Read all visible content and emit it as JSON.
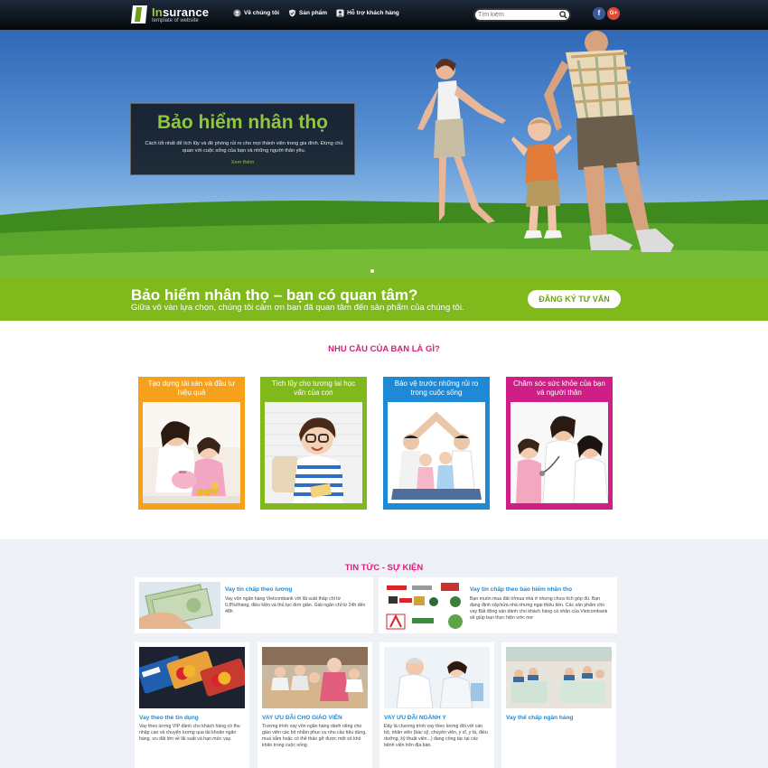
{
  "header": {
    "logo_brand_prefix": "In",
    "logo_brand_rest": "surance",
    "logo_tagline": "template of website",
    "nav": [
      {
        "label": "Về chúng tôi",
        "icon": "users-icon"
      },
      {
        "label": "Sản phẩm",
        "icon": "shield-icon"
      },
      {
        "label": "Hỗ trợ khách hàng",
        "icon": "support-icon"
      }
    ],
    "search_placeholder": "Tìm kiếm",
    "social": [
      {
        "label": "f",
        "icon": "facebook-icon",
        "color": "#3b5998"
      },
      {
        "label": "G+",
        "icon": "google-plus-icon",
        "color": "#dd4b39"
      }
    ]
  },
  "hero": {
    "title": "Bảo hiểm nhân thọ",
    "text": "Cách tốt nhất để tích lũy và đề phòng rủi ro cho mọi thành viên trong gia đình. Đừng chủ quan với cuộc sống của bạn và những người thân yêu.",
    "link": "Xem thêm"
  },
  "cta": {
    "title": "Bảo hiểm nhân thọ – bạn có quan tâm?",
    "subtitle": "Giữa vô vàn lựa chọn, chúng tôi cảm ơn bạn đã quan tâm đến sản phẩm của chúng tôi.",
    "button": "ĐĂNG KÝ TƯ VẤN"
  },
  "needs": {
    "title": "NHU CẦU CỦA BẠN LÀ GÌ?",
    "cards": [
      {
        "label": "Tạo dựng tài sản và đầu tư hiệu quả",
        "color": "#f7a11a"
      },
      {
        "label": "Tích lũy cho tương lai học vấn của con",
        "color": "#7fb91b"
      },
      {
        "label": "Bảo vệ trước những rủi ro trong cuộc sống",
        "color": "#1e8ad6"
      },
      {
        "label": "Chăm sóc sức khỏe của bạn và người thân",
        "color": "#cf1f86"
      }
    ]
  },
  "news": {
    "title": "TIN TỨC - SỰ KIỆN",
    "wide": [
      {
        "title": "Vay tín chấp theo lương",
        "text": "Vay vốn ngân hàng Vietcombank với lãi suất thấp chỉ từ 0,8%/tháng, điều kiện và thủ tục đơn giản. Giải ngân chỉ từ 24h đến 48h"
      },
      {
        "title": "Vay tín chấp theo bảo hiểm nhân thọ",
        "text": "Bạn muốn mua đất ở/mua nhà ở nhưng chưa tích góp đủ. Bạn đang định xây/sửa nhà nhưng ngại thiếu tiền. Các sản phẩm cho vay Bất động sản dành cho khách hàng cá nhân của Vietcombank sẽ giúp bạn thực hiện ước mơ"
      }
    ],
    "small": [
      {
        "title": "Vay theo thẻ tín dụng",
        "text": "Vay theo lương VIP dành cho khách hàng có thu nhập cao và chuyển lương qua tài khoản ngân hàng, ưu đãi lớn về lãi suất và hạn mức vay."
      },
      {
        "title": "VAY ƯU ĐÃI CHO GIÁO VIÊN",
        "text": "Trương trình vay vốn ngân hàng dành riêng cho giáo viên các bộ nhằm phục vụ nhu cầu tiêu dùng, mua sắm hoặc có thể thảo gỡ được một số khó khăn trong cuộc sống."
      },
      {
        "title": "VAY ƯU ĐÃI NGÀNH Y",
        "text": "Đây là chương trình vay theo lương đối với cán bộ, nhân viên (bác sỹ, chuyên viên, y sĩ, y tá, điều dưỡng, kỹ thuật viên...) đang công tác tại các bệnh viện trên địa bàn."
      },
      {
        "title": "Vay thế chấp ngân hàng",
        "text": ""
      }
    ]
  }
}
